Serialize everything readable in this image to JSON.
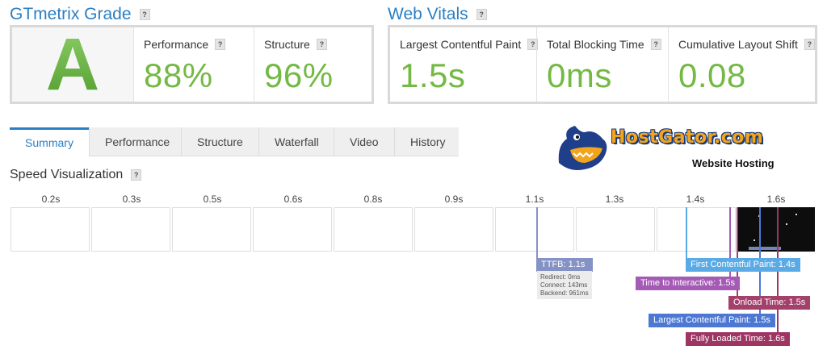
{
  "gtmetrix": {
    "title": "GTmetrix Grade",
    "help": "?",
    "grade": "A",
    "performance_label": "Performance",
    "performance_value": "88%",
    "structure_label": "Structure",
    "structure_value": "96%"
  },
  "vitals": {
    "title": "Web Vitals",
    "help": "?",
    "lcp_label": "Largest Contentful Paint",
    "lcp_value": "1.5s",
    "tbt_label": "Total Blocking Time",
    "tbt_value": "0ms",
    "cls_label": "Cumulative Layout Shift",
    "cls_value": "0.08"
  },
  "tabs": [
    "Summary",
    "Performance",
    "Structure",
    "Waterfall",
    "Video",
    "History"
  ],
  "active_tab": "Summary",
  "speed": {
    "title": "Speed Visualization",
    "help": "?",
    "ticks": [
      "0.2s",
      "0.3s",
      "0.5s",
      "0.6s",
      "0.8s",
      "0.9s",
      "1.1s",
      "1.3s",
      "1.4s",
      "1.6s"
    ]
  },
  "markers": {
    "ttfb": "TTFB: 1.1s",
    "ttfb_redirect": "Redirect: 0ms",
    "ttfb_connect": "Connect: 143ms",
    "ttfb_backend": "Backend: 961ms",
    "fcp": "First Contentful Paint: 1.4s",
    "tti": "Time to Interactive: 1.5s",
    "onload": "Onload Time: 1.5s",
    "lcp": "Largest Contentful Paint: 1.5s",
    "fully_loaded": "Fully Loaded Time: 1.6s"
  },
  "marker_colors": {
    "ttfb": "#8592c5",
    "fcp": "#5aaae6",
    "tti": "#a55bb5",
    "onload": "#a3416b",
    "lcp": "#4c78d4",
    "fully_loaded": "#9e3663"
  },
  "logo": {
    "name": "HostGator.com",
    "tagline": "Website Hosting",
    "icon": "gator-mascot-icon"
  }
}
